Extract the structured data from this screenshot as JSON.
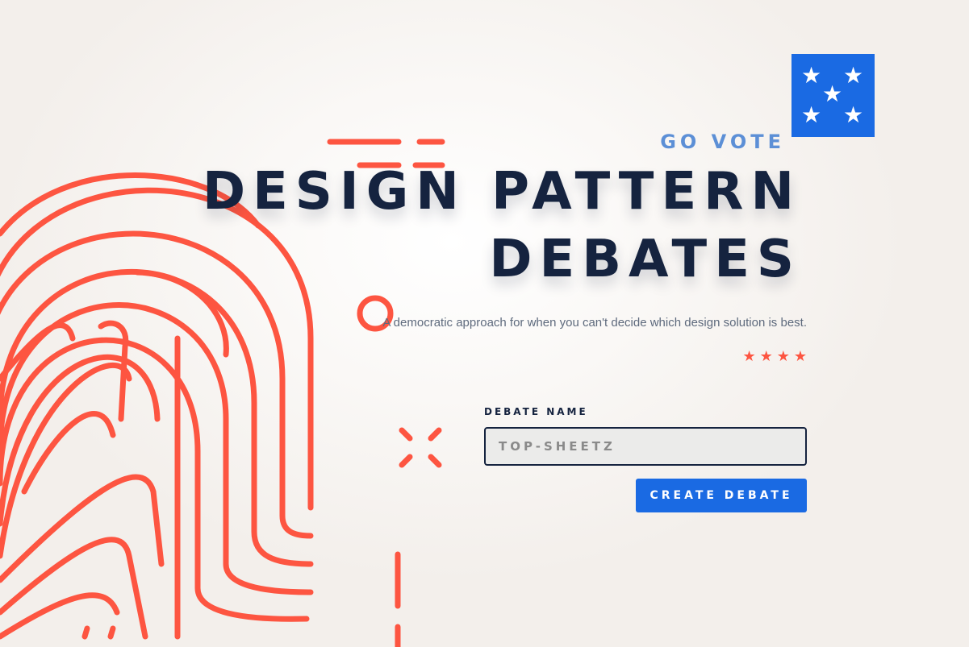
{
  "hero": {
    "eyebrow": "GO VOTE",
    "title_line_1": "DESIGN PATTERN",
    "title_line_2": "DEBATES",
    "subtitle": "A democratic approach for when you can't decide which design solution is best.",
    "stars": "★★★★"
  },
  "flag": {
    "star_glyph": "★",
    "star_count": 5,
    "color": "#1a6ae3"
  },
  "form": {
    "label": "DEBATE NAME",
    "input_value": "",
    "input_placeholder": "TOP-SHEETZ",
    "button_label": "CREATE DEBATE"
  },
  "colors": {
    "accent_red": "#fd5541",
    "primary_blue": "#1a6ae3",
    "navy": "#15233f",
    "eyebrow_blue": "#5c8fd6"
  },
  "icons": {
    "fingerprint": "fingerprint-icon",
    "flag": "flag-stars-icon"
  }
}
